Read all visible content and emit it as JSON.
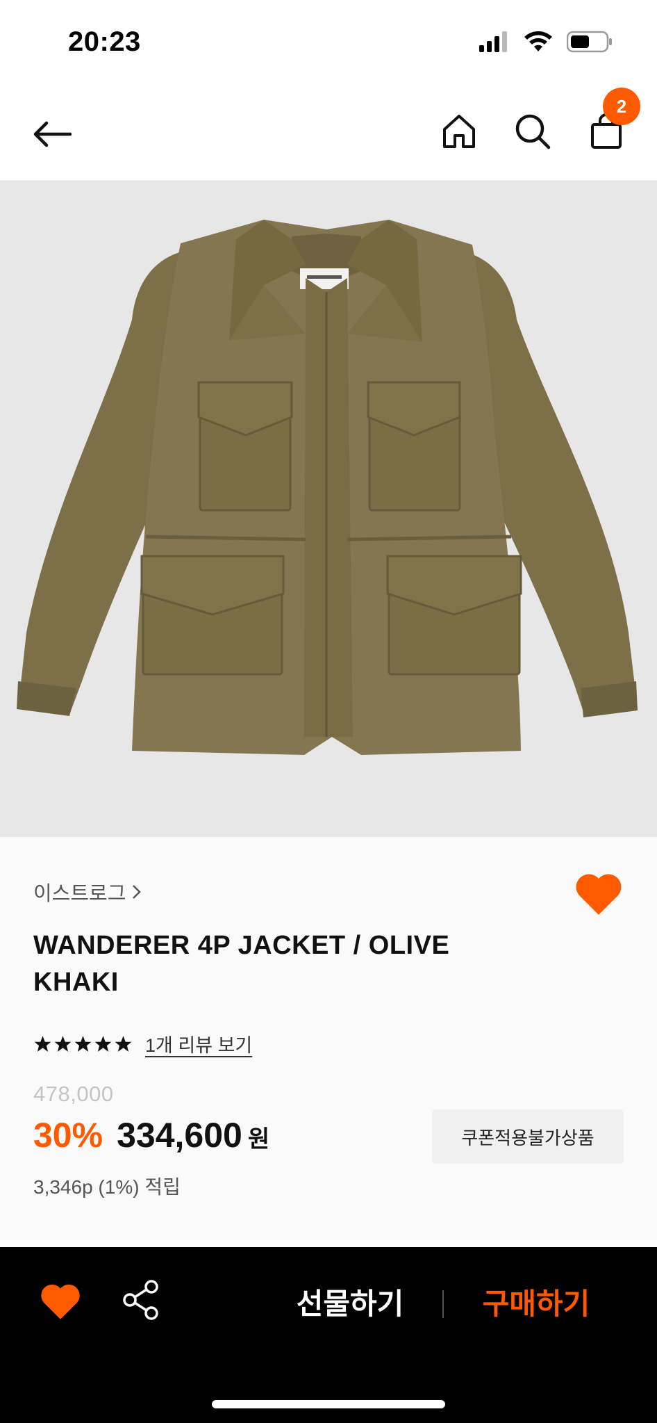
{
  "status_bar": {
    "time": "20:23"
  },
  "header": {
    "cart_count": "2"
  },
  "product": {
    "brand": "이스트로그",
    "title": "WANDERER 4P JACKET / OLIVE KHAKI",
    "review_link": "1개 리뷰 보기",
    "rating_stars": 5,
    "original_price": "478,000",
    "discount": "30%",
    "sale_price": "334,600",
    "currency": "원",
    "coupon_badge": "쿠폰적용불가상품",
    "points": "3,346p (1%) 적립"
  },
  "bottom_bar": {
    "gift_label": "선물하기",
    "buy_label": "구매하기"
  },
  "colors": {
    "accent": "#ff5a00",
    "image_bg": "#e8e7e8",
    "jacket": "#847651"
  }
}
